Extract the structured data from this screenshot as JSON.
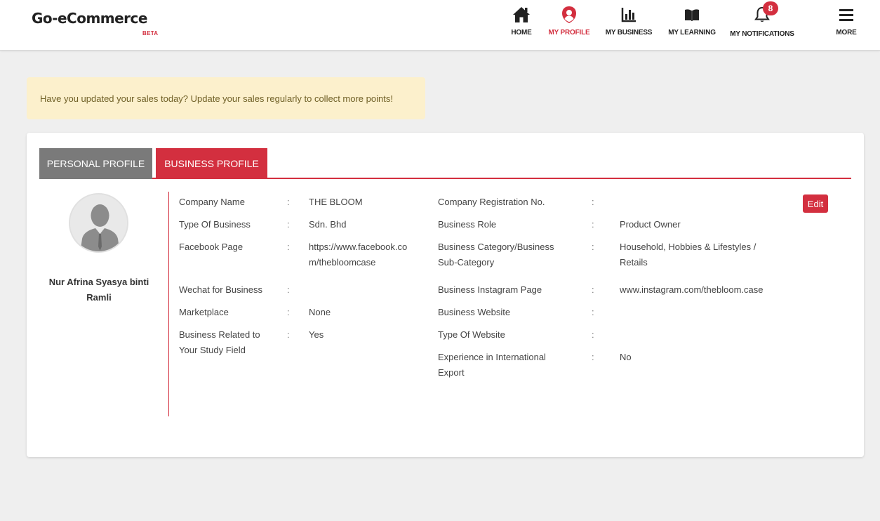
{
  "brand": {
    "name": "Go-eCommerce",
    "tag": "BETA"
  },
  "nav": {
    "home": "HOME",
    "profile": "MY PROFILE",
    "business": "MY BUSINESS",
    "learning": "MY LEARNING",
    "notifications": "MY NOTIFICATIONS",
    "notification_count": "8",
    "more": "MORE"
  },
  "alert": "Have you updated your sales today? Update your sales regularly to collect more points!",
  "tabs": {
    "personal": "PERSONAL PROFILE",
    "business": "BUSINESS PROFILE"
  },
  "user": {
    "name_line1": "Nur Afrina Syasya binti",
    "name_line2": "Ramli"
  },
  "edit_label": "Edit",
  "left_fields": [
    {
      "label": "Company Name",
      "value": "THE BLOOM"
    },
    {
      "label": "Type Of Business",
      "value": "Sdn. Bhd"
    },
    {
      "label": "Facebook Page",
      "value_line1": "https://www.facebook.co",
      "value_line2": "m/thebloomcase"
    },
    {
      "label": "Wechat for Business",
      "value": ""
    },
    {
      "label": "Marketplace",
      "value": "None"
    },
    {
      "label_line1": "Business Related to",
      "label_line2": "Your Study Field",
      "value": "Yes"
    }
  ],
  "right_fields": [
    {
      "label": "Company Registration No.",
      "value": ""
    },
    {
      "label": "Business Role",
      "value": "Product Owner"
    },
    {
      "label_line1": "Business Category/Business",
      "label_line2": "Sub-Category",
      "value_line1": "Household, Hobbies & Lifestyles /",
      "value_line2": "Retails"
    },
    {
      "label": "Business Instagram Page",
      "value": "www.instagram.com/thebloom.case"
    },
    {
      "label": "Business Website",
      "value": ""
    },
    {
      "label": "Type Of Website",
      "value": ""
    },
    {
      "label_line1": "Experience in International",
      "label_line2": "Export",
      "value": "No"
    }
  ],
  "colors": {
    "accent": "#d32f3f",
    "tab_inactive": "#7a7a7a",
    "alert_bg": "#fcf0cc"
  }
}
